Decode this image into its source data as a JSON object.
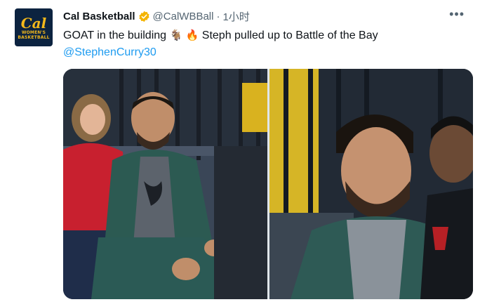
{
  "tweet": {
    "author": {
      "name": "Cal Basketball",
      "handle": "@CalWBBall",
      "avatar_logo": "Cal",
      "avatar_line1": "WOMEN'S",
      "avatar_line2": "BASKETBALL",
      "verified": true
    },
    "separator": "·",
    "time": "1小时",
    "more_icon": "more-dots-icon",
    "text_part1": "GOAT in the building ",
    "emoji1": "🐐",
    "emoji2": "🔥",
    "text_part2": " Steph pulled up to Battle of the Bay",
    "mention": "@StephenCurry30"
  },
  "colors": {
    "mention": "#1d9bf0",
    "verified": "#f4b400",
    "avatar_bg": "#0c2340",
    "avatar_gold": "#f3b81b"
  }
}
